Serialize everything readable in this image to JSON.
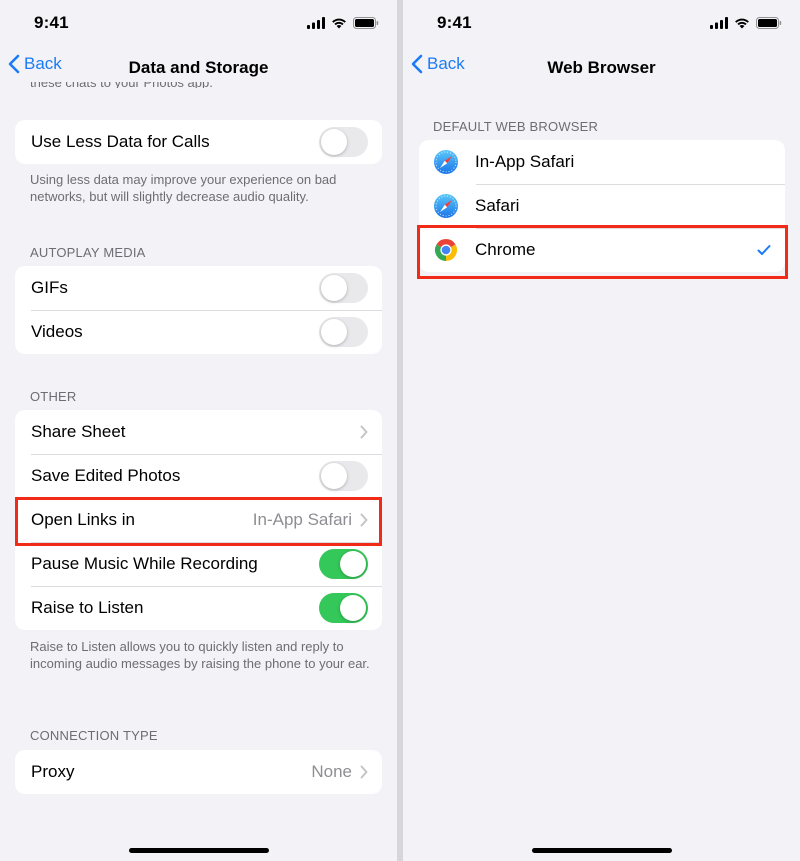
{
  "status": {
    "time": "9:41"
  },
  "left": {
    "nav": {
      "back_label": "Back",
      "title": "Data and Storage"
    },
    "clipped_text": "these chats to your Photos app.",
    "calls_group": {
      "items": [
        {
          "label": "Use Less Data for Calls",
          "toggle": false
        }
      ]
    },
    "calls_footnote": "Using less data may improve your experience on bad networks, but will slightly decrease audio quality.",
    "autoplay": {
      "header": "AUTOPLAY MEDIA",
      "items": [
        {
          "label": "GIFs",
          "toggle": false
        },
        {
          "label": "Videos",
          "toggle": false
        }
      ]
    },
    "other": {
      "header": "OTHER",
      "items": [
        {
          "label": "Share Sheet"
        },
        {
          "label": "Save Edited Photos",
          "toggle": false
        },
        {
          "label": "Open Links in",
          "value": "In-App Safari"
        },
        {
          "label": "Pause Music While Recording",
          "toggle": true
        },
        {
          "label": "Raise to Listen",
          "toggle": true
        }
      ],
      "footnote": "Raise to Listen allows you to quickly listen and reply to incoming audio messages by raising the phone to your ear."
    },
    "connection": {
      "header": "CONNECTION TYPE",
      "items": [
        {
          "label": "Proxy",
          "value": "None"
        }
      ]
    }
  },
  "right": {
    "nav": {
      "back_label": "Back",
      "title": "Web Browser"
    },
    "section_header": "DEFAULT WEB BROWSER",
    "browsers": [
      {
        "label": "In-App Safari",
        "icon": "safari-icon",
        "selected": false
      },
      {
        "label": "Safari",
        "icon": "safari-icon",
        "selected": false
      },
      {
        "label": "Chrome",
        "icon": "chrome-icon",
        "selected": true
      }
    ]
  },
  "colors": {
    "accent": "#1c7bf6",
    "toggle_on": "#34c759",
    "highlight": "#f12b17",
    "background": "#f2f2f7"
  }
}
